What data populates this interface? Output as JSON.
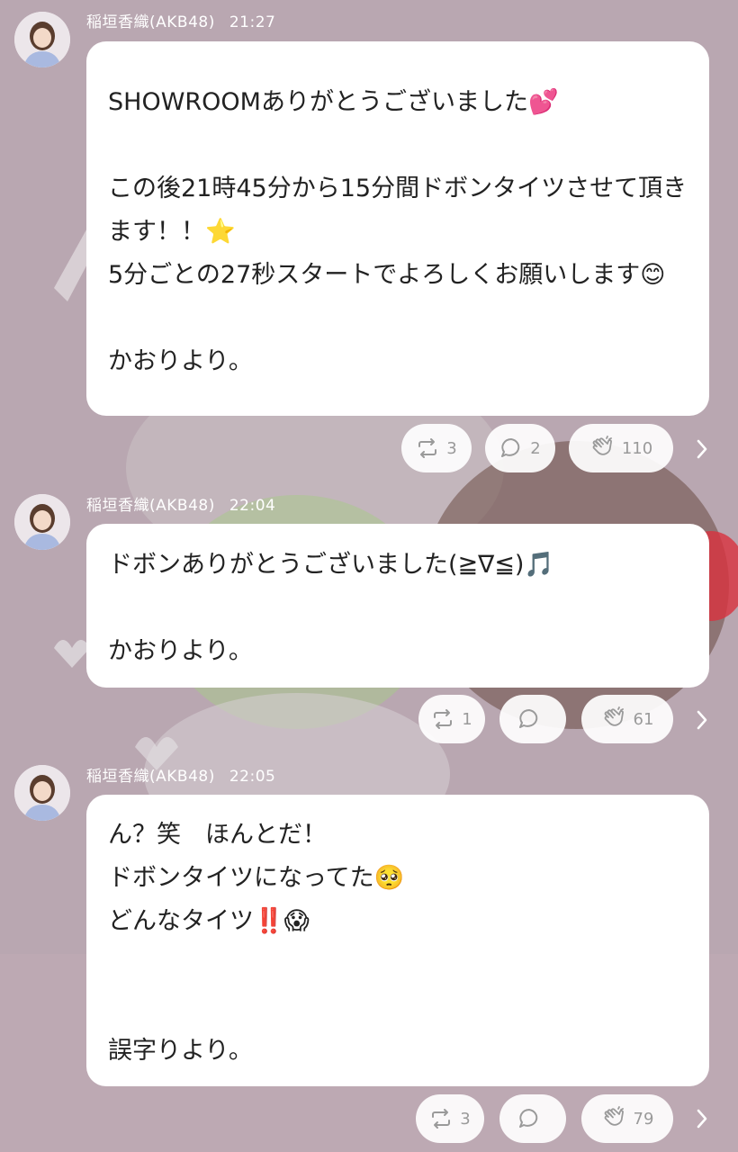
{
  "posts": [
    {
      "author": "稲垣香織(AKB48)",
      "time": "21:27",
      "text": "SHOWROOMありがとうございました💕\n\nこの後21時45分から15分間ドボンタイツさせて頂きます！！⭐\n5分ごとの27秒スタートでよろしくお願いします😊\n\nかおりより。",
      "retweets": "3",
      "comments": "2",
      "claps": "110"
    },
    {
      "author": "稲垣香織(AKB48)",
      "time": "22:04",
      "text": "ドボンありがとうございました(≧∇≦)🎵\n\nかおりより。",
      "retweets": "1",
      "comments": "",
      "claps": "61"
    },
    {
      "author": "稲垣香織(AKB48)",
      "time": "22:05",
      "text": "ん？笑　ほんとだ！\nドボンタイツになってた🥺\nどんなタイツ‼️😱\n\n\n誤字りより。",
      "retweets": "3",
      "comments": "",
      "claps": "79"
    }
  ],
  "icons": {
    "retweet": "retweet-icon",
    "comment": "comment-icon",
    "clap": "clap-icon",
    "more": "chevron-right-icon",
    "avatar": "avatar"
  },
  "colors": {
    "background": "#b8a6b0",
    "bubble": "#ffffff",
    "meta_text": "#ffffff",
    "action_text": "#9a9a9a"
  }
}
